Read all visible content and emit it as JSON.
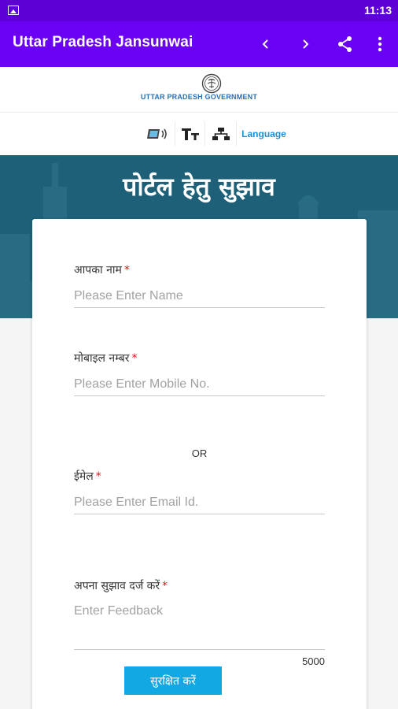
{
  "status_bar": {
    "time": "11:13",
    "notification_icon": "image-icon"
  },
  "app_bar": {
    "title": "Uttar Pradesh Jansunwai",
    "actions": [
      "back-icon",
      "forward-icon",
      "share-icon",
      "more-vert-icon"
    ]
  },
  "header": {
    "gov_name": "UTTAR PRADESH GOVERNMENT",
    "emblem_icon": "state-emblem-icon"
  },
  "toolbar": {
    "language_label": "Language",
    "icons": [
      "screen-reader-icon",
      "text-size-icon",
      "sitemap-icon"
    ]
  },
  "banner": {
    "title": "पोर्टल हेतु सुझाव"
  },
  "form": {
    "name": {
      "label": "आपका नाम",
      "required": "*",
      "placeholder": "Please Enter Name",
      "value": ""
    },
    "mobile": {
      "label": "मोबाइल नम्बर",
      "required": "*",
      "placeholder": "Please Enter Mobile No.",
      "value": ""
    },
    "or_text": "OR",
    "email": {
      "label": "ईमेल",
      "required": "*",
      "placeholder": "Please Enter Email Id.",
      "value": ""
    },
    "feedback": {
      "label": "अपना सुझाव दर्ज करें",
      "required": "*",
      "placeholder": "Enter Feedback",
      "value": ""
    },
    "char_count": "5000",
    "save_label": "सुरक्षित करें"
  },
  "colors": {
    "status_bar": "#5c00d6",
    "app_bar": "#6a00f4",
    "banner": "#1d6077",
    "button": "#11a8e4",
    "required": "#e0141e"
  }
}
